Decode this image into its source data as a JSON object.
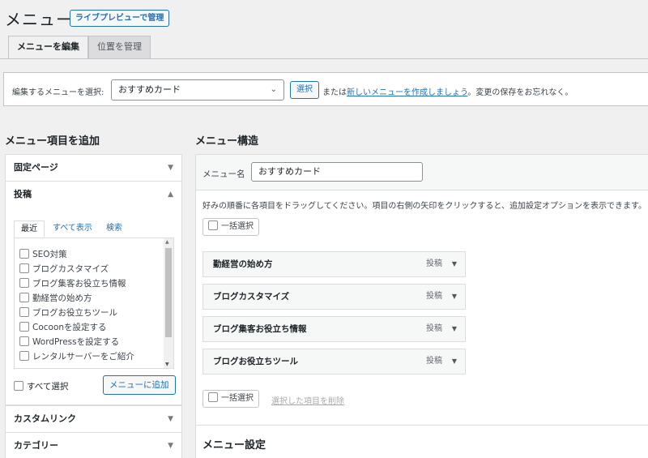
{
  "header": {
    "title": "メニュー",
    "live_preview_button": "ライブプレビューで管理"
  },
  "tabs": [
    {
      "label": "メニューを編集",
      "active": true
    },
    {
      "label": "位置を管理",
      "active": false
    }
  ],
  "select_bar": {
    "label": "編集するメニューを選択:",
    "selected_menu": "おすすめカード",
    "select_button": "選択",
    "text_before": "または",
    "create_link": "新しいメニューを作成しましょう",
    "text_after": "。変更の保存をお忘れなく。"
  },
  "add_items": {
    "title": "メニュー項目を追加",
    "sections": [
      {
        "label": "固定ページ",
        "expanded": false
      },
      {
        "label": "投稿",
        "expanded": true
      },
      {
        "label": "カスタムリンク",
        "expanded": false
      },
      {
        "label": "カテゴリー",
        "expanded": false
      }
    ],
    "inner_tabs": [
      "最近",
      "すべて表示",
      "検索"
    ],
    "posts": [
      "SEO対策",
      "ブログカスタマイズ",
      "ブログ集客お役立ち情報",
      "勤経営の始め方",
      "ブログお役立ちツール",
      "Cocoonを設定する",
      "WordPressを設定する",
      "レンタルサーバーをご紹介"
    ],
    "select_all": "すべて選択",
    "add_button": "メニューに追加"
  },
  "structure": {
    "title": "メニュー構造",
    "name_label": "メニュー名",
    "name_value": "おすすめカード",
    "instructions": "好みの順番に各項目をドラッグしてください。項目の右側の矢印をクリックすると、追加設定オプションを表示できます。",
    "bulk_select": "一括選択",
    "delete_selected": "選択した項目を削除",
    "items": [
      {
        "title": "勤経営の始め方",
        "type": "投稿"
      },
      {
        "title": "ブログカスタマイズ",
        "type": "投稿"
      },
      {
        "title": "ブログ集客お役立ち情報",
        "type": "投稿"
      },
      {
        "title": "ブログお役立ちツール",
        "type": "投稿"
      }
    ]
  },
  "settings": {
    "title": "メニュー設定"
  },
  "colors": {
    "accent": "#2271b1",
    "background": "#f0f0f1",
    "panel": "#ffffff",
    "border": "#dcdcde"
  }
}
